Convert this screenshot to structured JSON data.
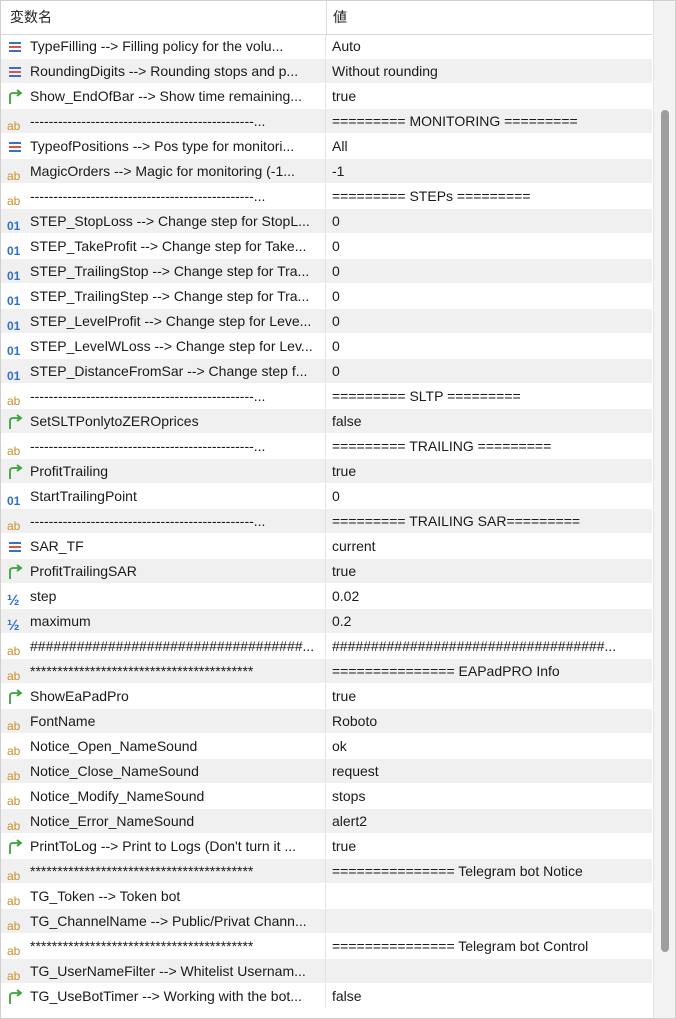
{
  "header": {
    "col_name": "変数名",
    "col_value": "値"
  },
  "colors": {
    "alt_row": "#f0f0f0",
    "ab_icon": "#c8902a",
    "num_icon": "#2f6fd1",
    "enum_icon": "#3a6fc9",
    "bool_icon": "#3aa33a"
  },
  "rows": [
    {
      "icon": "enum",
      "name": "TypeFilling --> Filling policy for the volu...",
      "value": "Auto"
    },
    {
      "icon": "enum",
      "name": "RoundingDigits --> Rounding stops and p...",
      "value": "Without rounding"
    },
    {
      "icon": "bool",
      "name": "Show_EndOfBar --> Show time remaining...",
      "value": "true"
    },
    {
      "icon": "ab",
      "name": "------------------------------------------------...",
      "value": "=========  MONITORING ========="
    },
    {
      "icon": "enum",
      "name": "TypeofPositions --> Pos type for monitori...",
      "value": "All"
    },
    {
      "icon": "ab",
      "name": "MagicOrders --> Magic for monitoring (-1...",
      "value": "-1"
    },
    {
      "icon": "ab",
      "name": "------------------------------------------------...",
      "value": "=========  STEPs ========="
    },
    {
      "icon": "int",
      "name": "STEP_StopLoss --> Change step for StopL...",
      "value": "0"
    },
    {
      "icon": "int",
      "name": "STEP_TakeProfit --> Change step for Take...",
      "value": "0"
    },
    {
      "icon": "int",
      "name": "STEP_TrailingStop --> Change step for Tra...",
      "value": "0"
    },
    {
      "icon": "int",
      "name": "STEP_TrailingStep --> Change step for Tra...",
      "value": "0"
    },
    {
      "icon": "int",
      "name": "STEP_LevelProfit --> Change step for Leve...",
      "value": "0"
    },
    {
      "icon": "int",
      "name": "STEP_LevelWLoss --> Change step for Lev...",
      "value": "0"
    },
    {
      "icon": "int",
      "name": "STEP_DistanceFromSar --> Change step f...",
      "value": "0"
    },
    {
      "icon": "ab",
      "name": "------------------------------------------------...",
      "value": "=========  SLTP ========="
    },
    {
      "icon": "bool",
      "name": "SetSLTPonlytoZEROprices",
      "value": "false"
    },
    {
      "icon": "ab",
      "name": "------------------------------------------------...",
      "value": "=========  TRAILING ========="
    },
    {
      "icon": "bool",
      "name": "ProfitTrailing",
      "value": "true"
    },
    {
      "icon": "int",
      "name": "StartTrailingPoint",
      "value": "0"
    },
    {
      "icon": "ab",
      "name": "------------------------------------------------...",
      "value": "=========  TRAILING SAR========="
    },
    {
      "icon": "enum",
      "name": "SAR_TF",
      "value": "current"
    },
    {
      "icon": "bool",
      "name": "ProfitTrailingSAR",
      "value": "true"
    },
    {
      "icon": "dbl",
      "name": "step",
      "value": "0.02"
    },
    {
      "icon": "dbl",
      "name": "maximum",
      "value": "0.2"
    },
    {
      "icon": "ab",
      "name": "###################################...",
      "value": "###################################..."
    },
    {
      "icon": "ab",
      "name": "*****************************************",
      "value": " =============== EAPadPRO Info"
    },
    {
      "icon": "bool",
      "name": "ShowEaPadPro",
      "value": "true"
    },
    {
      "icon": "ab",
      "name": "FontName",
      "value": "Roboto"
    },
    {
      "icon": "ab",
      "name": "Notice_Open_NameSound",
      "value": "ok"
    },
    {
      "icon": "ab",
      "name": "Notice_Close_NameSound",
      "value": "request"
    },
    {
      "icon": "ab",
      "name": "Notice_Modify_NameSound",
      "value": "stops"
    },
    {
      "icon": "ab",
      "name": "Notice_Error_NameSound",
      "value": "alert2"
    },
    {
      "icon": "bool",
      "name": "PrintToLog --> Print to Logs (Don't turn it ...",
      "value": "true"
    },
    {
      "icon": "ab",
      "name": "*****************************************",
      "value": " =============== Telegram bot Notice"
    },
    {
      "icon": "ab",
      "name": "TG_Token --> Token bot",
      "value": ""
    },
    {
      "icon": "ab",
      "name": "TG_ChannelName --> Public/Privat Chann...",
      "value": ""
    },
    {
      "icon": "ab",
      "name": "*****************************************",
      "value": " =============== Telegram bot Control"
    },
    {
      "icon": "ab",
      "name": "TG_UserNameFilter --> Whitelist Usernam...",
      "value": ""
    },
    {
      "icon": "bool",
      "name": "TG_UseBotTimer --> Working with the bot...",
      "value": "false"
    }
  ]
}
